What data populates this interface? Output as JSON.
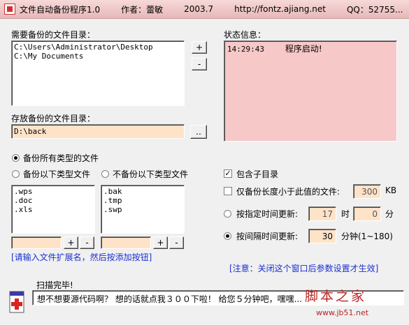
{
  "titlebar": {
    "app_name": "文件自动备份程序1.0",
    "author": "作者：蕾敏",
    "version": "2003.7",
    "url": "http://fontz.ajiang.net",
    "qq": "QQ：52755..."
  },
  "source": {
    "label": "需要备份的文件目录：",
    "items": [
      "C:\\Users\\Administrator\\Desktop",
      "C:\\My Documents"
    ],
    "add_label": "+",
    "remove_label": "-"
  },
  "status": {
    "label": "状态信息：",
    "time": "14:29:43",
    "message": "程序启动!"
  },
  "dest": {
    "label": "存放备份的文件目录：",
    "value": "D:\\back",
    "browse_label": ".."
  },
  "filetypes": {
    "all_label": "备份所有类型的文件",
    "include_label": "备份以下类型文件",
    "exclude_label": "不备份以下类型文件",
    "include_list": [
      ".wps",
      ".doc",
      ".xls"
    ],
    "exclude_list": [
      ".bak",
      ".tmp",
      ".swp"
    ],
    "plus": "+",
    "minus": "-",
    "hint": "[请输入文件扩展名，然后按添加按钮]"
  },
  "options": {
    "include_subdirs": "包含子目录",
    "size_limit_label": "仅备份长度小于此值的文件:",
    "size_value": "300",
    "size_unit": "KB",
    "at_time_label": "按指定时间更新:",
    "hour_value": "17",
    "hour_unit": "时",
    "minute_value": "0",
    "minute_unit": "分",
    "interval_label": "按间隔时间更新:",
    "interval_value": "30",
    "interval_unit": "分钟(1~180)",
    "note": "[注意：关闭这个窗口后参数设置才生效]"
  },
  "bottom": {
    "scan_label": "扫描完毕!",
    "message": "想不想要源代码啊？ 想的话就点我３００下啦！ 给您５分钟吧，嘿嘿...",
    "watermark_cn": "脚本之家",
    "watermark_url": "www.jb51.net"
  }
}
